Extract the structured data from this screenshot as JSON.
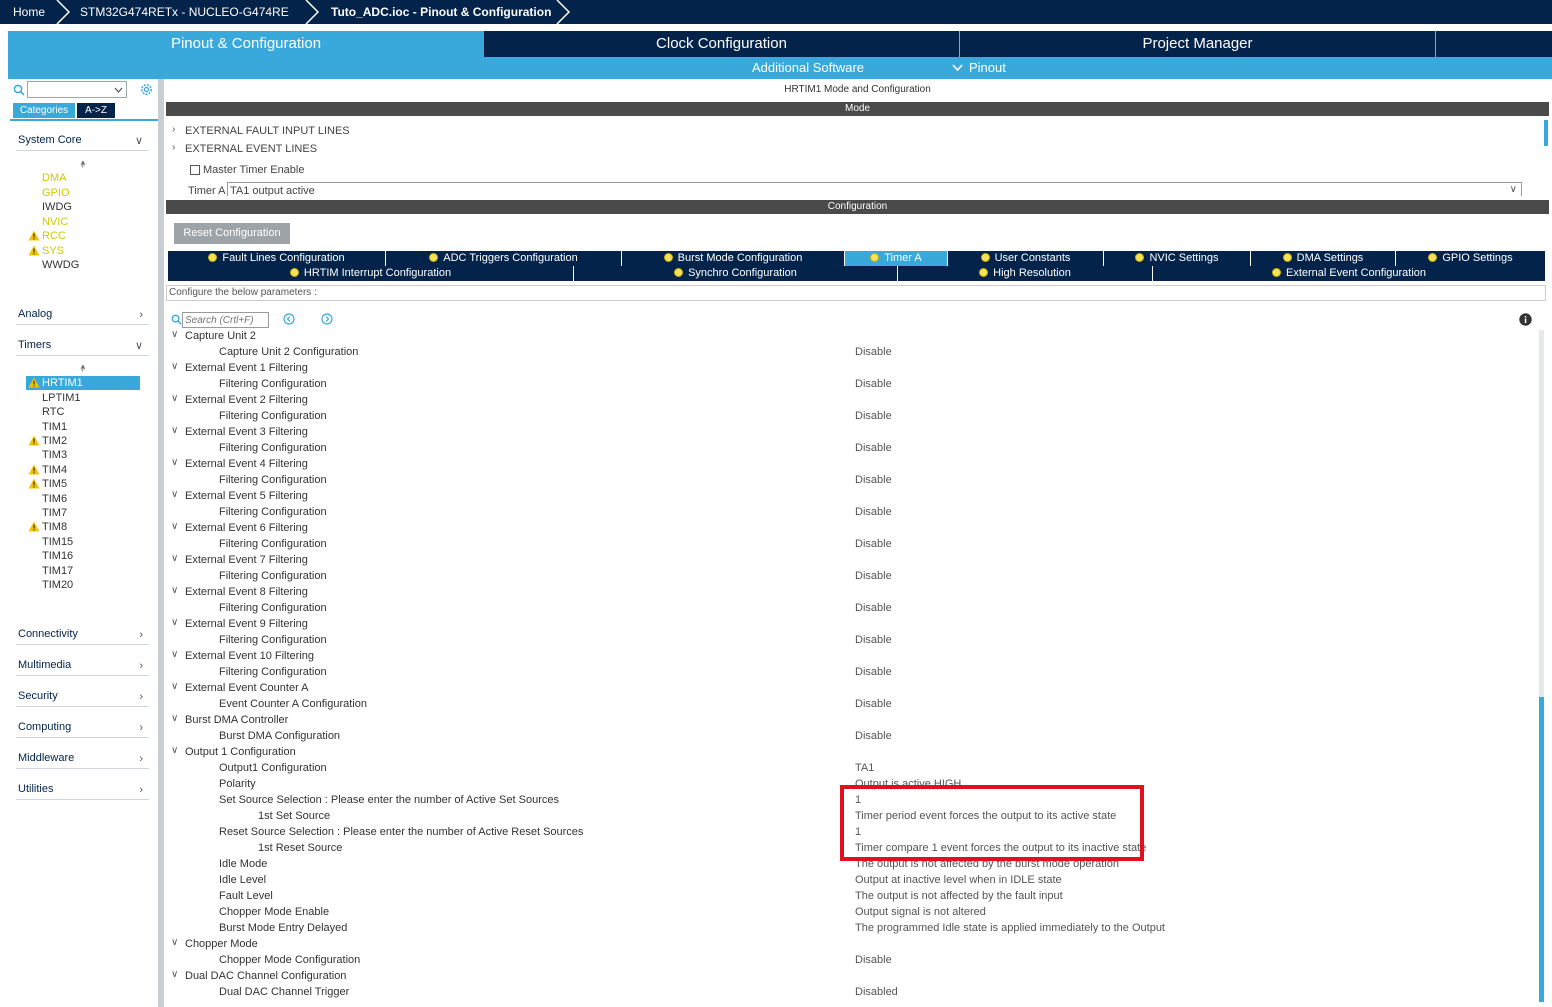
{
  "breadcrumb": {
    "home": "Home",
    "device": "STM32G474RETx  -  NUCLEO-G474RE",
    "file": "Tuto_ADC.ioc - Pinout & Configuration"
  },
  "main_tabs": {
    "pinout": "Pinout & Configuration",
    "clock": "Clock Configuration",
    "project": "Project Manager"
  },
  "sub_tabs": {
    "additional_software": "Additional Software",
    "pinout": "Pinout"
  },
  "left_panel": {
    "tab_categories": "Categories",
    "tab_az": "A->Z",
    "system_core": {
      "label": "System Core",
      "items": [
        "DMA",
        "GPIO",
        "IWDG",
        "NVIC",
        "RCC",
        "SYS",
        "WWDG"
      ]
    },
    "analog": "Analog",
    "timers": {
      "label": "Timers",
      "items": [
        "HRTIM1",
        "LPTIM1",
        "RTC",
        "TIM1",
        "TIM2",
        "TIM3",
        "TIM4",
        "TIM5",
        "TIM6",
        "TIM7",
        "TIM8",
        "TIM15",
        "TIM16",
        "TIM17",
        "TIM20"
      ]
    },
    "connectivity": "Connectivity",
    "multimedia": "Multimedia",
    "security": "Security",
    "computing": "Computing",
    "middleware": "Middleware",
    "utilities": "Utilities"
  },
  "mode_panel": {
    "title": "HRTIM1 Mode and Configuration",
    "mode_header": "Mode",
    "external_fault": "EXTERNAL FAULT INPUT LINES",
    "external_event": "EXTERNAL EVENT LINES",
    "master_timer": "Master Timer Enable",
    "timer_a_label": "Timer A",
    "timer_a_value": "TA1 output active"
  },
  "config_panel": {
    "header": "Configuration",
    "reset_button": "Reset Configuration",
    "tabs_row1": [
      "Fault Lines Configuration",
      "ADC Triggers Configuration",
      "Burst Mode Configuration",
      "Timer A",
      "User Constants",
      "NVIC Settings",
      "DMA Settings",
      "GPIO Settings"
    ],
    "tabs_row2": [
      "HRTIM Interrupt Configuration",
      "Synchro Configuration",
      "High Resolution",
      "External Event Configuration"
    ],
    "configure_text": "Configure the below parameters :",
    "search_placeholder": "Search (Crtl+F)"
  },
  "params": [
    {
      "label": "Capture Unit 2",
      "group": true,
      "value": ""
    },
    {
      "label": "Capture Unit 2 Configuration",
      "group": false,
      "value": "Disable"
    },
    {
      "label": "External Event 1 Filtering",
      "group": true,
      "value": ""
    },
    {
      "label": "Filtering Configuration",
      "group": false,
      "value": "Disable"
    },
    {
      "label": "External Event 2 Filtering",
      "group": true,
      "value": ""
    },
    {
      "label": "Filtering Configuration",
      "group": false,
      "value": "Disable"
    },
    {
      "label": "External Event 3 Filtering",
      "group": true,
      "value": ""
    },
    {
      "label": "Filtering Configuration",
      "group": false,
      "value": "Disable"
    },
    {
      "label": "External Event 4 Filtering",
      "group": true,
      "value": ""
    },
    {
      "label": "Filtering Configuration",
      "group": false,
      "value": "Disable"
    },
    {
      "label": "External Event 5 Filtering",
      "group": true,
      "value": ""
    },
    {
      "label": "Filtering Configuration",
      "group": false,
      "value": "Disable"
    },
    {
      "label": "External Event 6 Filtering",
      "group": true,
      "value": ""
    },
    {
      "label": "Filtering Configuration",
      "group": false,
      "value": "Disable"
    },
    {
      "label": "External Event 7 Filtering",
      "group": true,
      "value": ""
    },
    {
      "label": "Filtering Configuration",
      "group": false,
      "value": "Disable"
    },
    {
      "label": "External Event 8 Filtering",
      "group": true,
      "value": ""
    },
    {
      "label": "Filtering Configuration",
      "group": false,
      "value": "Disable"
    },
    {
      "label": "External Event 9 Filtering",
      "group": true,
      "value": ""
    },
    {
      "label": "Filtering Configuration",
      "group": false,
      "value": "Disable"
    },
    {
      "label": "External Event 10 Filtering",
      "group": true,
      "value": ""
    },
    {
      "label": "Filtering Configuration",
      "group": false,
      "value": "Disable"
    },
    {
      "label": "External Event Counter A",
      "group": true,
      "value": ""
    },
    {
      "label": "Event Counter A Configuration",
      "group": false,
      "value": "Disable"
    },
    {
      "label": "Burst DMA Controller",
      "group": true,
      "value": ""
    },
    {
      "label": "Burst DMA Configuration",
      "group": false,
      "value": "Disable"
    },
    {
      "label": "Output 1 Configuration",
      "group": true,
      "value": ""
    },
    {
      "label": "Output1 Configuration",
      "group": false,
      "value": "TA1"
    },
    {
      "label": "Polarity",
      "group": false,
      "value": "Output is active HIGH"
    },
    {
      "label": "Set Source  Selection : Please enter the number of Active Set Sources",
      "group": false,
      "value": "1"
    },
    {
      "label": "1st Set Source",
      "group": false,
      "deep": true,
      "value": "Timer period event forces the output to its active state"
    },
    {
      "label": "Reset Source  Selection : Please enter the number of Active Reset Sources",
      "group": false,
      "value": "1"
    },
    {
      "label": "1st Reset Source",
      "group": false,
      "deep": true,
      "value": "Timer compare 1 event forces the output to its inactive state"
    },
    {
      "label": "Idle Mode",
      "group": false,
      "value": "The output is not affected by the burst mode operation"
    },
    {
      "label": "Idle Level",
      "group": false,
      "value": "Output at inactive level when in IDLE state"
    },
    {
      "label": "Fault Level",
      "group": false,
      "value": "The output is not affected by the fault input"
    },
    {
      "label": "Chopper Mode Enable",
      "group": false,
      "value": "Output signal is not altered"
    },
    {
      "label": "Burst Mode Entry Delayed",
      "group": false,
      "value": "The programmed Idle state is applied immediately to the Output"
    },
    {
      "label": "Chopper Mode",
      "group": true,
      "value": ""
    },
    {
      "label": "Chopper Mode Configuration",
      "group": false,
      "value": "Disable"
    },
    {
      "label": "Dual DAC Channel Configuration",
      "group": true,
      "value": ""
    },
    {
      "label": "Dual DAC Channel Trigger",
      "group": false,
      "value": "Disabled"
    }
  ],
  "colors": {
    "navy": "#03234b",
    "accent_blue": "#39a9dc",
    "warning_yellow": "#f5c400",
    "highlight_red": "#e0101e"
  }
}
